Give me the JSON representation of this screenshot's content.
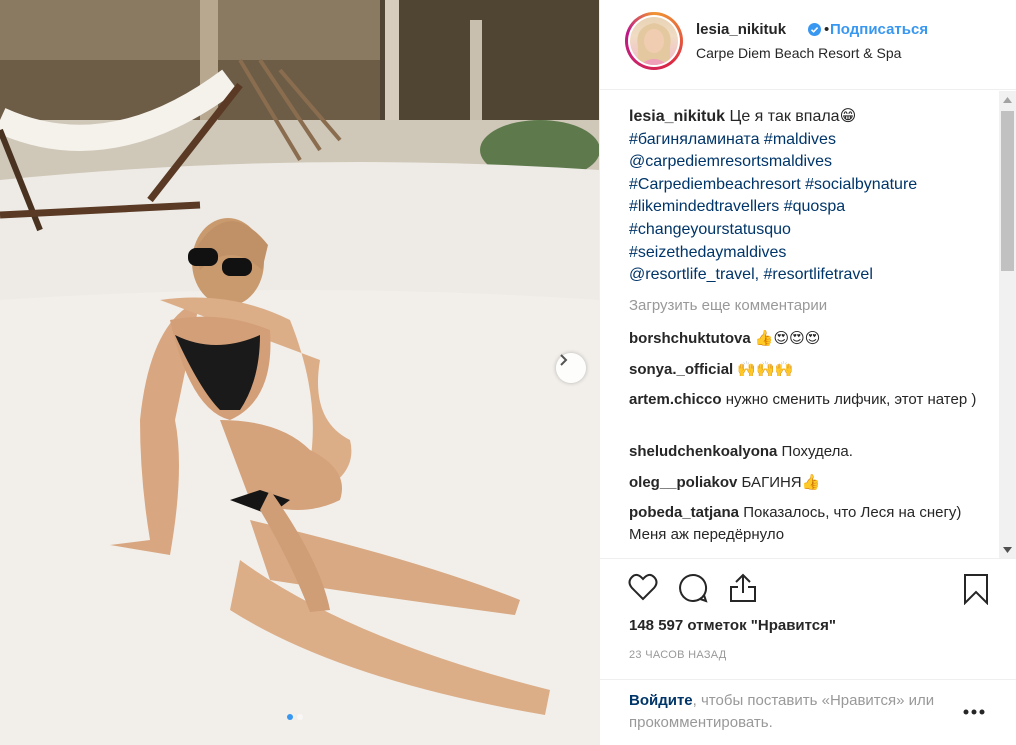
{
  "post": {
    "username": "lesia_nikituk",
    "bullet": "•",
    "follow_label": "Подписаться",
    "location": "Carpe Diem Beach Resort & Spa"
  },
  "caption": {
    "username": "lesia_nikituk",
    "text": "Це я так впала😁",
    "tags": [
      "#багиняламината #maldives",
      "@carpediemresortsmaldives",
      "#Carpediembeachresort #socialbynature",
      "#likemindedtravellers #quospa",
      "#changeyourstatusquo",
      "#seizethedaymaldives",
      "@resortlife_travel, #resortlifetravel"
    ]
  },
  "load_more": "Загрузить еще комментарии",
  "comments": [
    {
      "user": "borshchuktutova",
      "text": "👍😍😍😍"
    },
    {
      "user": "sonya._official",
      "text": "🙌🙌🙌"
    },
    {
      "user": "artem.chicco",
      "text": "нужно сменить лифчик, этот натер )"
    },
    {
      "user": "sheludchenkoalyona",
      "text": "Похудела."
    },
    {
      "user": "oleg__poliakov",
      "text": "БАГИНЯ👍"
    },
    {
      "user": "pobeda_tatjana",
      "text": "Показалось, что Леся на снегу) Меня аж передёрнуло"
    }
  ],
  "likes": "148 597 отметок \"Нравится\"",
  "time": "23 ЧАСОВ НАЗАД",
  "login": {
    "link": "Войдите",
    "text": ", чтобы поставить «Нравится» или прокомментировать."
  },
  "icons": {
    "like": "heart-icon",
    "comment": "comment-icon",
    "share": "share-icon",
    "save": "bookmark-icon",
    "more": "more-icon",
    "next": "chevron-right-icon",
    "verified": "verified-badge-icon"
  },
  "colors": {
    "link": "#003569",
    "accent": "#3897f0",
    "muted": "#999999",
    "text": "#262626"
  }
}
